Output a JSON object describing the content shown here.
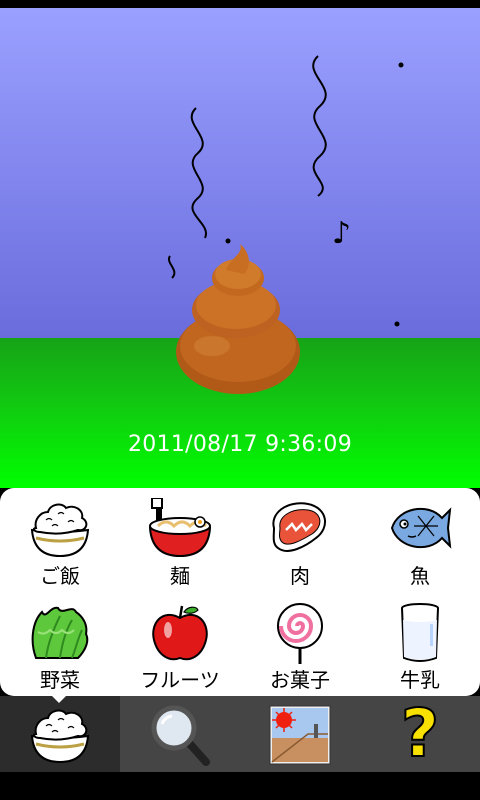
{
  "scene": {
    "timestamp": "2011/08/17 9:36:09",
    "music_note": "♪",
    "colors": {
      "sky_top": "#9aa0ff",
      "grass": "#12c512",
      "poop": "#c0651c"
    }
  },
  "food_menu": {
    "items": [
      {
        "label": "ご飯",
        "icon": "rice-bowl-icon"
      },
      {
        "label": "麺",
        "icon": "ramen-icon"
      },
      {
        "label": "肉",
        "icon": "meat-icon"
      },
      {
        "label": "魚",
        "icon": "fish-icon"
      },
      {
        "label": "野菜",
        "icon": "lettuce-icon"
      },
      {
        "label": "フルーツ",
        "icon": "apple-icon"
      },
      {
        "label": "お菓子",
        "icon": "lollipop-icon"
      },
      {
        "label": "牛乳",
        "icon": "milk-glass-icon"
      }
    ]
  },
  "tabbar": {
    "tabs": [
      {
        "icon": "rice-bowl-icon",
        "selected": true
      },
      {
        "icon": "magnifier-icon",
        "selected": false
      },
      {
        "icon": "picture-icon",
        "selected": false
      },
      {
        "icon": "question-mark-icon",
        "selected": false
      }
    ],
    "help_glyph": "?"
  }
}
